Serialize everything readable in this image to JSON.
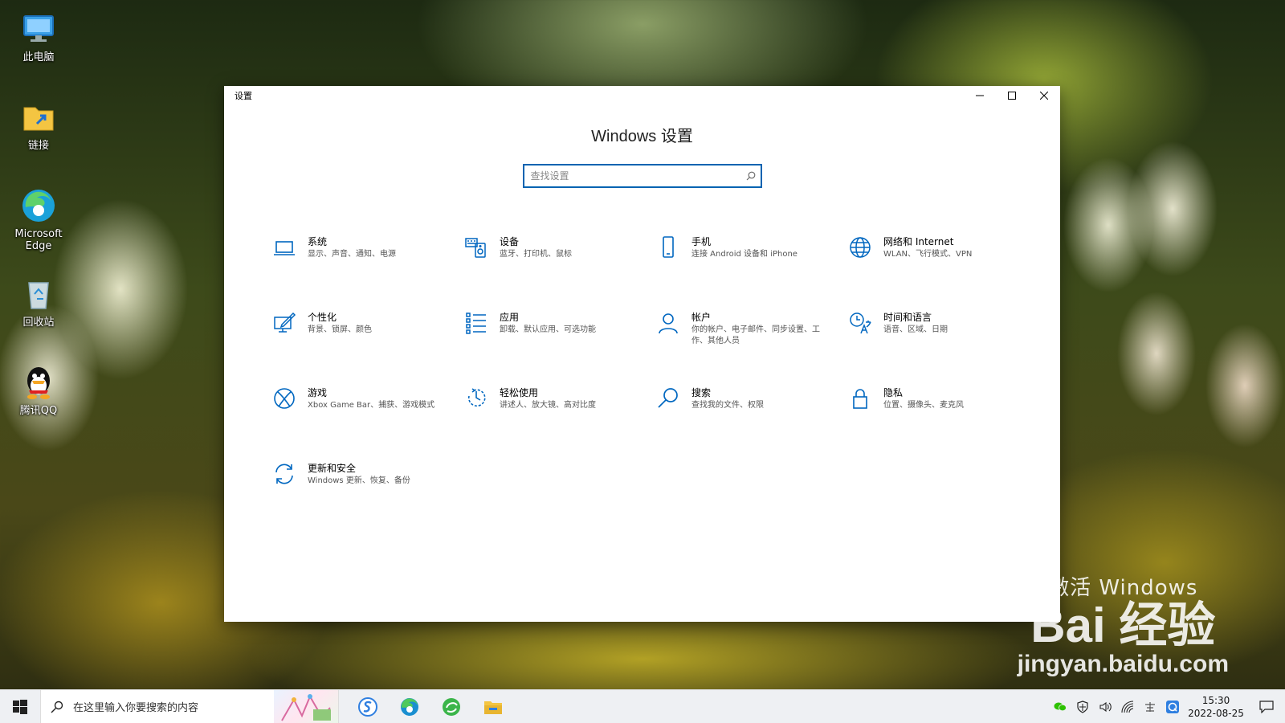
{
  "desktop": {
    "icons": [
      {
        "label": "此电脑",
        "icon": "computer-icon"
      },
      {
        "label": "链接",
        "icon": "shortcut-folder-icon"
      },
      {
        "label": "Microsoft Edge",
        "icon": "edge-icon"
      },
      {
        "label": "回收站",
        "icon": "recycle-bin-icon"
      },
      {
        "label": "腾讯QQ",
        "icon": "qq-icon"
      }
    ]
  },
  "window": {
    "title": "设置",
    "heading": "Windows 设置",
    "search_placeholder": "查找设置",
    "controls": [
      "minimize",
      "maximize",
      "close"
    ]
  },
  "tiles": [
    {
      "name": "系统",
      "desc": "显示、声音、通知、电源",
      "icon": "laptop-icon"
    },
    {
      "name": "设备",
      "desc": "蓝牙、打印机、鼠标",
      "icon": "devices-icon"
    },
    {
      "name": "手机",
      "desc": "连接 Android 设备和 iPhone",
      "icon": "phone-icon"
    },
    {
      "name": "网络和 Internet",
      "desc": "WLAN、飞行模式、VPN",
      "icon": "globe-icon"
    },
    {
      "name": "个性化",
      "desc": "背景、锁屏、颜色",
      "icon": "personalize-icon"
    },
    {
      "name": "应用",
      "desc": "卸载、默认应用、可选功能",
      "icon": "apps-list-icon"
    },
    {
      "name": "帐户",
      "desc": "你的帐户、电子邮件、同步设置、工作、其他人员",
      "icon": "person-icon"
    },
    {
      "name": "时间和语言",
      "desc": "语音、区域、日期",
      "icon": "time-language-icon"
    },
    {
      "name": "游戏",
      "desc": "Xbox Game Bar、捕获、游戏模式",
      "icon": "xbox-icon"
    },
    {
      "name": "轻松使用",
      "desc": "讲述人、放大镜、高对比度",
      "icon": "ease-of-access-icon"
    },
    {
      "name": "搜索",
      "desc": "查找我的文件、权限",
      "icon": "search-icon"
    },
    {
      "name": "隐私",
      "desc": "位置、摄像头、麦克风",
      "icon": "lock-icon"
    },
    {
      "name": "更新和安全",
      "desc": "Windows 更新、恢复、备份",
      "icon": "update-icon"
    }
  ],
  "watermark": {
    "top": "激活 Windows",
    "brand": "Bai 经验",
    "url": "jingyan.baidu.com"
  },
  "taskbar": {
    "search_placeholder": "在这里输入你要搜索的内容",
    "apps": [
      "sogou-icon",
      "edge-icon",
      "browser-icon",
      "file-explorer-icon"
    ],
    "tray": [
      "wechat-icon",
      "security-icon",
      "volume-icon",
      "network-icon",
      "ime-icon",
      "qq-tray-icon"
    ],
    "time": "15:30",
    "date": "2022-08-25"
  },
  "colors": {
    "accent": "#0063b1",
    "icon_blue": "#0067c0",
    "window_bg": "#ffffff",
    "taskbar_bg": "#eef0f3"
  }
}
